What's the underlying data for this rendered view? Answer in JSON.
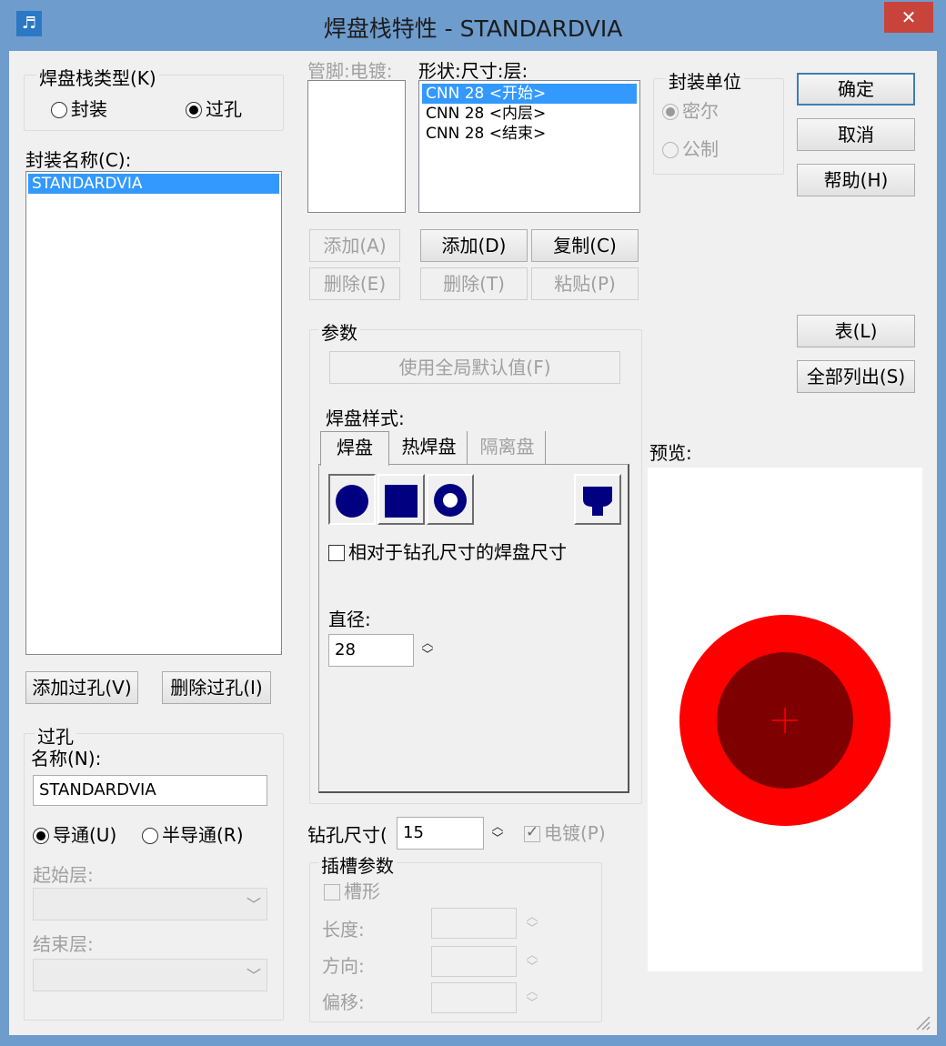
{
  "window": {
    "title": "焊盘栈特性 - STANDARDVIA",
    "app_icon_glyph": "♬",
    "close_glyph": "✕"
  },
  "stack_type": {
    "label": "焊盘栈类型(K)",
    "options": [
      "封装",
      "过孔"
    ],
    "selected": "过孔"
  },
  "package_name": {
    "label": "封装名称(C):",
    "items": [
      "STANDARDVIA"
    ],
    "add_button": "添加过孔(V)",
    "delete_button": "删除过孔(I)"
  },
  "via": {
    "group_label": "过孔",
    "name_label": "名称(N):",
    "name_value": "STANDARDVIA",
    "through_label": "导通(U)",
    "partial_label": "半导通(R)",
    "start_layer_label": "起始层:",
    "end_layer_label": "结束层:"
  },
  "pins": {
    "label": "管脚:电镀:",
    "add_button": "添加(A)",
    "delete_button": "删除(E)"
  },
  "shape_size_layer": {
    "label": "形状:尺寸:层:",
    "items": [
      "CNN 28 <开始>",
      "CNN 28 <内层>",
      "CNN 28 <结束>"
    ],
    "selected_index": 0,
    "add_button": "添加(D)",
    "copy_button": "复制(C)",
    "delete_button": "删除(T)",
    "paste_button": "粘贴(P)"
  },
  "units": {
    "label": "封装单位",
    "mil": "密尔",
    "metric": "公制"
  },
  "buttons": {
    "ok": "确定",
    "cancel": "取消",
    "help": "帮助(H)",
    "table": "表(L)",
    "list_all": "全部列出(S)"
  },
  "params": {
    "label": "参数",
    "use_global_defaults": "使用全局默认值(F)",
    "pad_style_label": "焊盘样式:",
    "tabs": [
      "焊盘",
      "热焊盘",
      "隔离盘"
    ],
    "relative_checkbox": "相对于钻孔尺寸的焊盘尺寸",
    "diameter_label": "直径:",
    "diameter_value": "28"
  },
  "drill": {
    "label": "钻孔尺寸(",
    "value": "15",
    "plated_label": "电镀(P)"
  },
  "slot": {
    "label": "插槽参数",
    "slotted_label": "槽形",
    "length_label": "长度:",
    "direction_label": "方向:",
    "offset_label": "偏移:"
  },
  "preview": {
    "label": "预览:",
    "pad_color": "#ff0000",
    "drill_color": "#7f0000"
  },
  "colors": {
    "pad_shape_fill": "#000080",
    "selection": "#3399ff"
  },
  "icons": {
    "spin": "up-down-arrows-icon",
    "combo": "chevron-down-icon"
  }
}
